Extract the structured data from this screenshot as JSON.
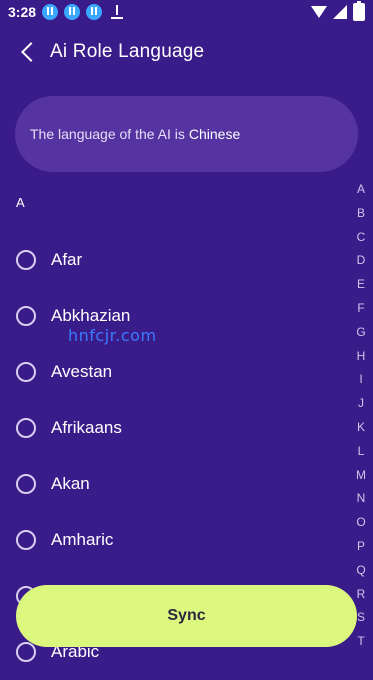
{
  "status_bar": {
    "time": "3:28",
    "icons": [
      "download-badge-icon",
      "download-badge-icon",
      "download-badge-icon",
      "download-icon",
      "wifi-icon",
      "signal-icon",
      "battery-icon"
    ]
  },
  "header": {
    "back_icon": "back-arrow-icon",
    "title": "Ai Role Language"
  },
  "info_card": {
    "label": "The language of the AI is",
    "value": "Chinese"
  },
  "section": {
    "header": "A"
  },
  "languages": [
    {
      "label": "Afar",
      "selected": false
    },
    {
      "label": "Abkhazian",
      "selected": false
    },
    {
      "label": "Avestan",
      "selected": false
    },
    {
      "label": "Afrikaans",
      "selected": false
    },
    {
      "label": "Akan",
      "selected": false
    },
    {
      "label": "Amharic",
      "selected": false
    },
    {
      "label": "",
      "selected": false
    },
    {
      "label": "Arabic",
      "selected": false
    }
  ],
  "watermark": "hnfcjr.com",
  "alphabet_index": [
    "A",
    "B",
    "C",
    "D",
    "E",
    "F",
    "G",
    "H",
    "I",
    "J",
    "K",
    "L",
    "M",
    "N",
    "O",
    "P",
    "Q",
    "R",
    "S",
    "T"
  ],
  "actions": {
    "sync_label": "Sync"
  },
  "colors": {
    "background": "#3a1b8a",
    "card": "#5533a0",
    "accent": "#dcf77d"
  }
}
